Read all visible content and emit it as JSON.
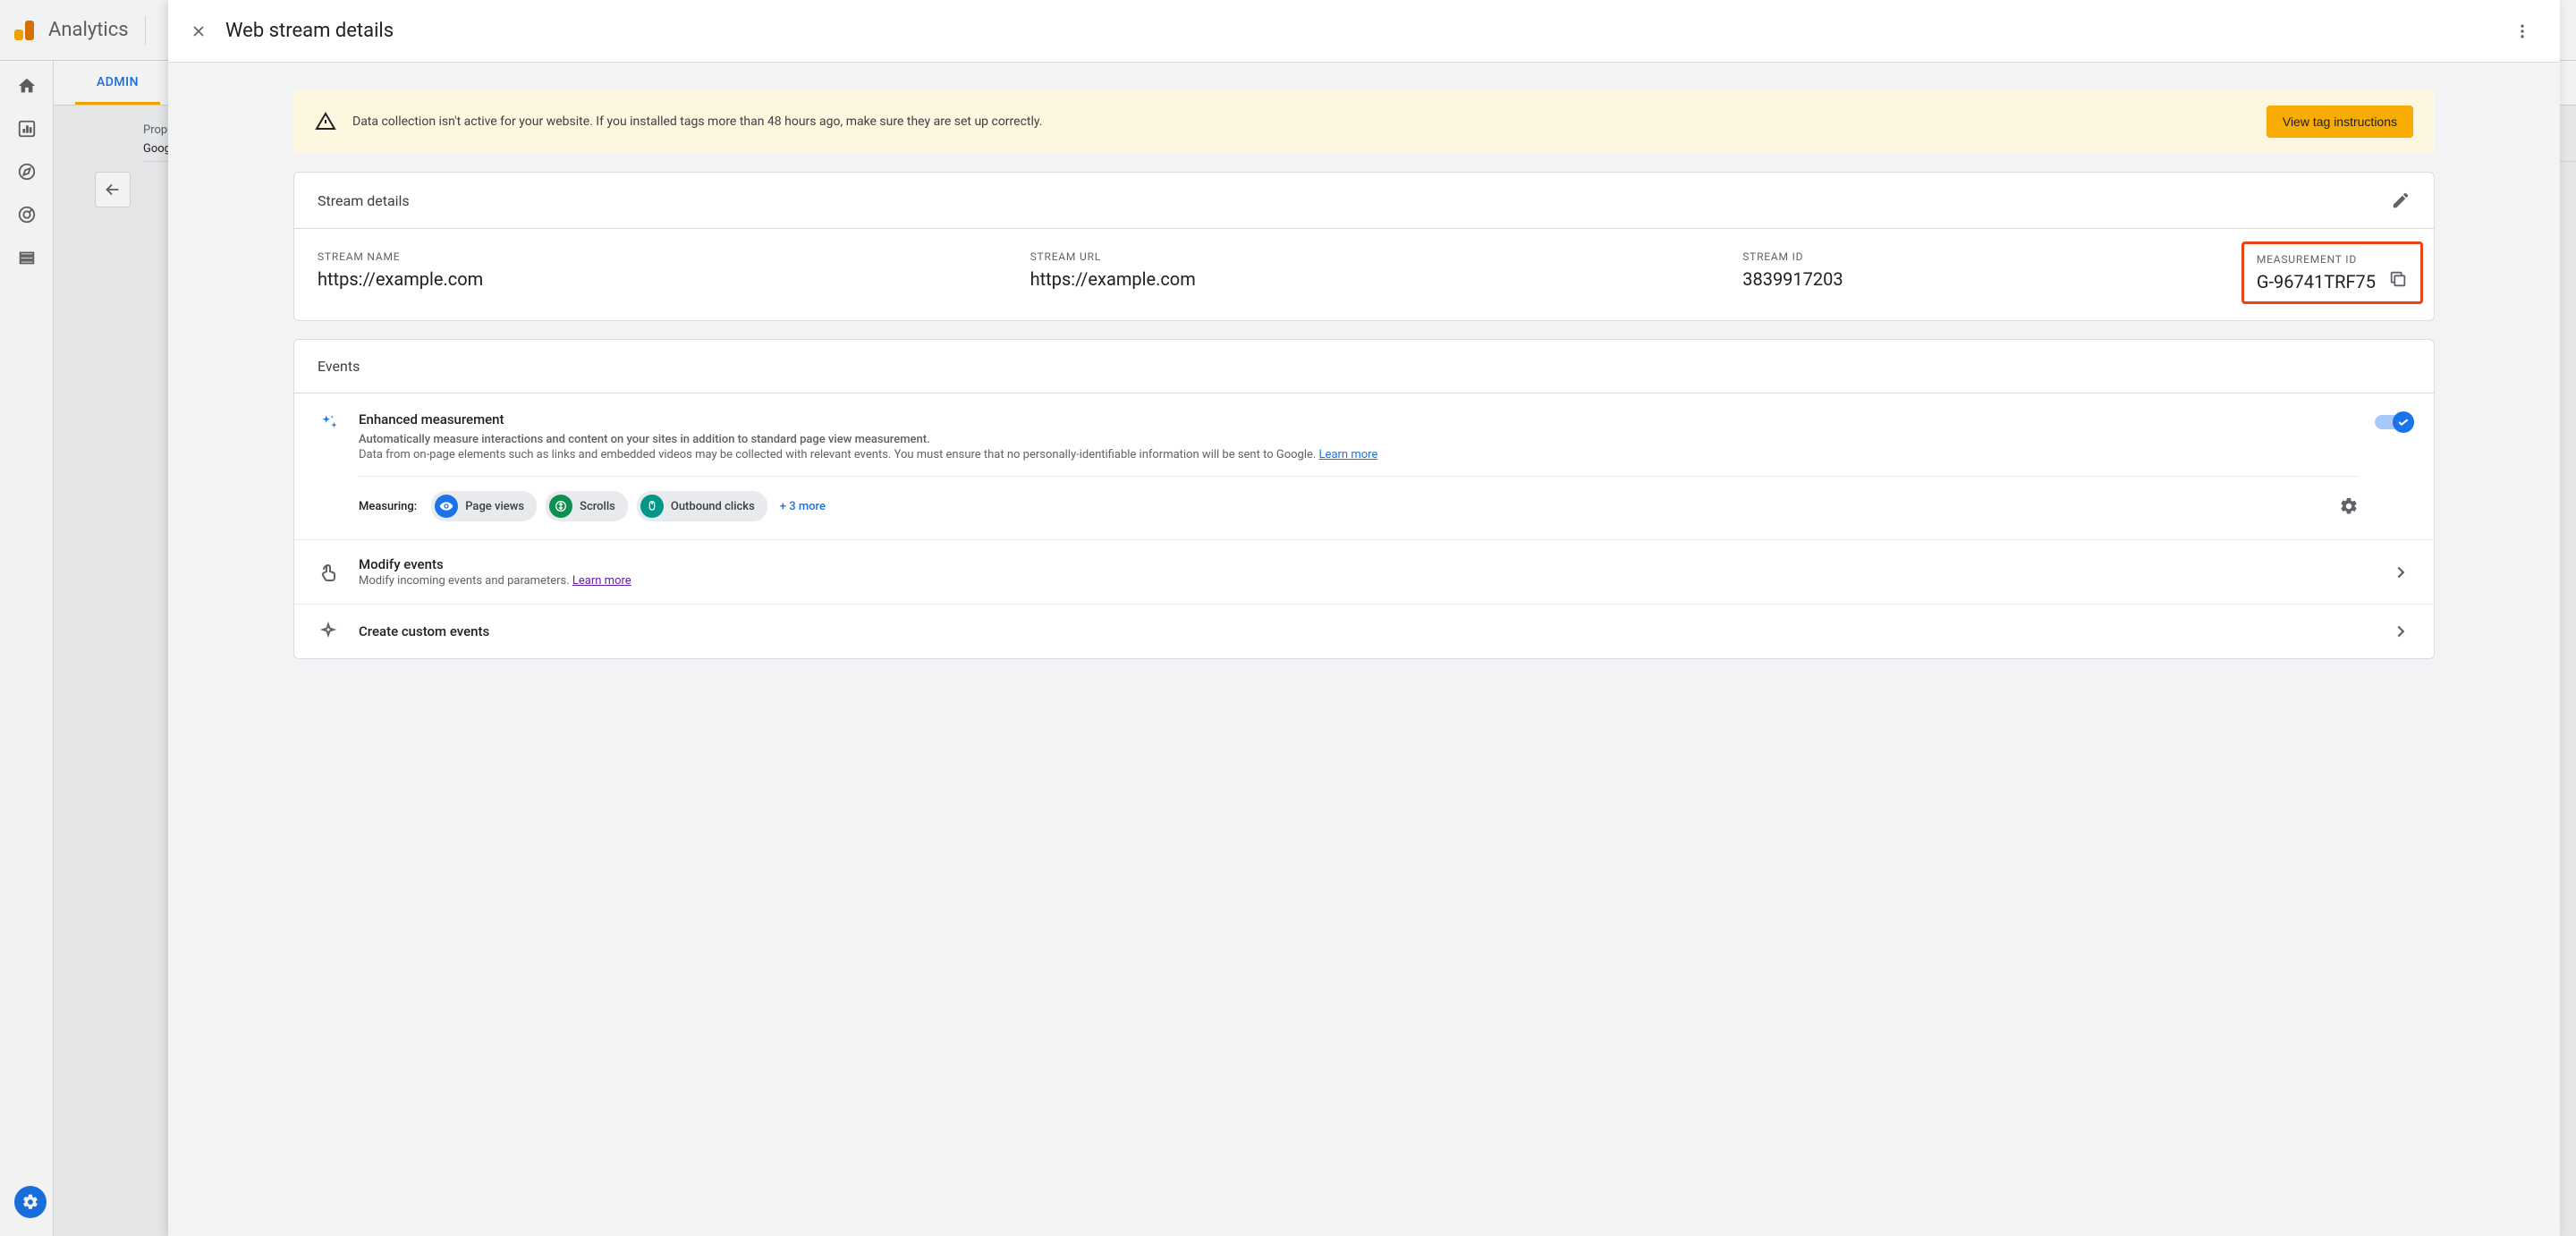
{
  "app": {
    "name": "Analytics"
  },
  "admin": {
    "tab": "ADMIN",
    "property_label": "Prope",
    "property_value": "Goog"
  },
  "modal": {
    "title": "Web stream details"
  },
  "alert": {
    "text": "Data collection isn't active for your website. If you installed tags more than 48 hours ago, make sure they are set up correctly.",
    "button": "View tag instructions"
  },
  "stream": {
    "section_title": "Stream details",
    "name_label": "STREAM NAME",
    "name_value": "https://example.com",
    "url_label": "STREAM URL",
    "url_value": "https://example.com",
    "id_label": "STREAM ID",
    "id_value": "3839917203",
    "measurement_label": "MEASUREMENT ID",
    "measurement_value": "G-96741TRF75"
  },
  "events": {
    "section_title": "Events",
    "enhanced": {
      "title": "Enhanced measurement",
      "desc1": "Automatically measure interactions and content on your sites in addition to standard page view measurement.",
      "desc2": "Data from on-page elements such as links and embedded videos may be collected with relevant events. You must ensure that no personally-identifiable information will be sent to Google.",
      "learn_more": "Learn more",
      "measuring_label": "Measuring:",
      "chips": [
        {
          "label": "Page views",
          "color": "chip-blue",
          "icon": "eye"
        },
        {
          "label": "Scrolls",
          "color": "chip-green",
          "icon": "scroll"
        },
        {
          "label": "Outbound clicks",
          "color": "chip-teal",
          "icon": "mouse"
        }
      ],
      "more": "+ 3 more"
    },
    "modify": {
      "title": "Modify events",
      "desc": "Modify incoming events and parameters.",
      "learn_more": "Learn more"
    },
    "create": {
      "title": "Create custom events"
    }
  }
}
